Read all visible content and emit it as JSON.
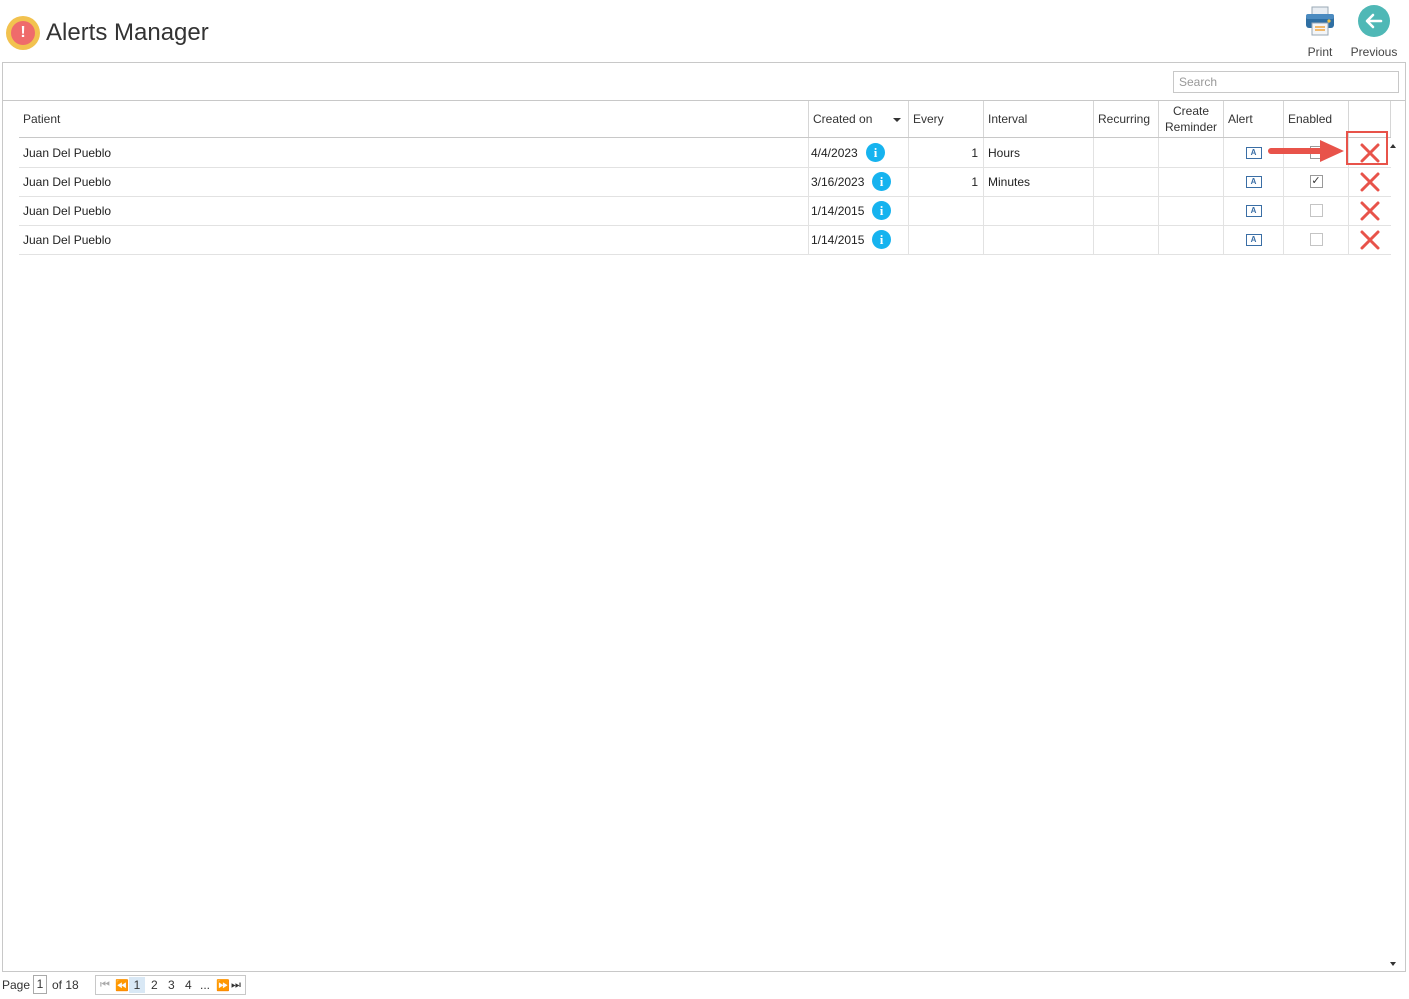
{
  "app": {
    "title": "Alerts Manager",
    "logo_icon": "exclamation-circle-icon",
    "logo_glyph": "!",
    "colors": {
      "logo_outer": "#f2c24f",
      "logo_inner": "#ef6b6b"
    }
  },
  "toolbar": {
    "print_label": "Print",
    "previous_label": "Previous",
    "print_icon": "printer-icon",
    "previous_icon": "arrow-left-circle-icon"
  },
  "search": {
    "placeholder": "Search",
    "value": ""
  },
  "grid": {
    "columns": [
      "Patient",
      "Created on",
      "Every",
      "Interval",
      "Recurring",
      "Create Reminder",
      "Alert",
      "Enabled",
      ""
    ],
    "sort_column": "Created on",
    "sort_direction": "descending",
    "rows": [
      {
        "patient": "Juan Del Pueblo",
        "created_on": "4/4/2023",
        "every": "1",
        "interval": "Hours",
        "recurring": "",
        "create_reminder": "",
        "enabled": false,
        "enabled_glyph": ""
      },
      {
        "patient": "Juan Del Pueblo",
        "created_on": "3/16/2023",
        "every": "1",
        "interval": "Minutes",
        "recurring": "",
        "create_reminder": "",
        "enabled": true,
        "enabled_glyph": "✓"
      },
      {
        "patient": "Juan Del Pueblo",
        "created_on": "1/14/2015",
        "every": "",
        "interval": "",
        "recurring": "",
        "create_reminder": "",
        "enabled": false,
        "enabled_glyph": ""
      },
      {
        "patient": "Juan Del Pueblo",
        "created_on": "1/14/2015",
        "every": "",
        "interval": "",
        "recurring": "",
        "create_reminder": "",
        "enabled": false,
        "enabled_glyph": ""
      }
    ],
    "info_glyph": "i",
    "alert_glyph": "A",
    "icons": {
      "info": "info-circle-icon",
      "alert": "alert-text-icon",
      "delete": "delete-x-icon"
    },
    "colors": {
      "info": "#16b3ef",
      "delete": "#e8534a",
      "annotation": "#e8534a"
    }
  },
  "pager": {
    "page_label": "Page",
    "current_page": "1",
    "of_label": "of 18",
    "pages": [
      "1",
      "2",
      "3",
      "4"
    ],
    "ellipsis": "...",
    "first_glyph": "⏮",
    "prev_glyph": "⏪",
    "next_glyph": "⏩",
    "last_glyph": "⏭"
  }
}
